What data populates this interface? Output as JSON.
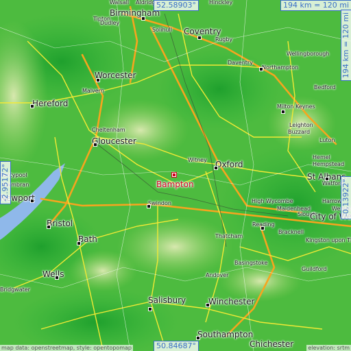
{
  "colors": {
    "lowland": "#2fb43a",
    "midland": "#71c74b",
    "upland": "#cfe4a4",
    "motorway": "#f7a51e",
    "road": "#f3ea35",
    "water": "#8fb8ea",
    "target": "#d3001e",
    "coord": "#3a6fc7"
  },
  "target": {
    "name": "Bampton"
  },
  "coords": {
    "top": "52.58903°",
    "bottom": "50.84687°",
    "left": "-2.95172°",
    "right": "-0.13922°"
  },
  "scale": {
    "top": "194 km = 120 mi",
    "right": "194 km = 120 mi"
  },
  "attribution": {
    "left": "map data: openstreetmap, style: opentopomap",
    "right": "elevation: srtm"
  },
  "places": [
    {
      "name": "Walsall",
      "cls": "small"
    },
    {
      "name": "Aldridge",
      "cls": "small"
    },
    {
      "name": "Birmingham",
      "cls": "city"
    },
    {
      "name": "Tipton",
      "cls": "small"
    },
    {
      "name": "Dudley",
      "cls": "small"
    },
    {
      "name": "Solihull",
      "cls": "small"
    },
    {
      "name": "Hinckley",
      "cls": "small"
    },
    {
      "name": "Coventry",
      "cls": "city"
    },
    {
      "name": "Rugby",
      "cls": "small"
    },
    {
      "name": "Wellingborough",
      "cls": "small"
    },
    {
      "name": "Daventry",
      "cls": "small"
    },
    {
      "name": "Northampton",
      "cls": "small"
    },
    {
      "name": "Worcester",
      "cls": "city"
    },
    {
      "name": "Malvern",
      "cls": "small"
    },
    {
      "name": "Bedford",
      "cls": "small"
    },
    {
      "name": "Hereford",
      "cls": "city"
    },
    {
      "name": "Milton Keynes",
      "cls": "small"
    },
    {
      "name": "Cheltenham",
      "cls": "small"
    },
    {
      "name": "Leighton",
      "cls": "small"
    },
    {
      "name": "Buzzard",
      "cls": "small"
    },
    {
      "name": "Gloucester",
      "cls": "city"
    },
    {
      "name": "Luton",
      "cls": "small"
    },
    {
      "name": "Witney",
      "cls": "small"
    },
    {
      "name": "Oxford",
      "cls": "city"
    },
    {
      "name": "Hemel",
      "cls": "small"
    },
    {
      "name": "Hempstead",
      "cls": "small"
    },
    {
      "name": "St Albans",
      "cls": "city"
    },
    {
      "name": "Watford",
      "cls": "small"
    },
    {
      "name": "Pontypool",
      "cls": "small"
    },
    {
      "name": "Cwmbran",
      "cls": "small"
    },
    {
      "name": "Newport",
      "cls": "city"
    },
    {
      "name": "Swindon",
      "cls": "small"
    },
    {
      "name": "High Wycombe",
      "cls": "small"
    },
    {
      "name": "Harrow",
      "cls": "small"
    },
    {
      "name": "Wembley",
      "cls": "small"
    },
    {
      "name": "Maidenhead",
      "cls": "small"
    },
    {
      "name": "Slough",
      "cls": "small"
    },
    {
      "name": "City of Westminster",
      "cls": "city"
    },
    {
      "name": "Bristol",
      "cls": "city"
    },
    {
      "name": "Reading",
      "cls": "small"
    },
    {
      "name": "Bracknell",
      "cls": "small"
    },
    {
      "name": "Thatcham",
      "cls": "small"
    },
    {
      "name": "Kingston upon Thames",
      "cls": "small"
    },
    {
      "name": "Bath",
      "cls": "city"
    },
    {
      "name": "Basingstoke",
      "cls": "small"
    },
    {
      "name": "Guildford",
      "cls": "small"
    },
    {
      "name": "Wells",
      "cls": "city"
    },
    {
      "name": "Andover",
      "cls": "small"
    },
    {
      "name": "Bridgwater",
      "cls": "small"
    },
    {
      "name": "Winchester",
      "cls": "city"
    },
    {
      "name": "Salisbury",
      "cls": "city"
    },
    {
      "name": "Southampton",
      "cls": "city"
    },
    {
      "name": "Chichester",
      "cls": "city"
    }
  ]
}
